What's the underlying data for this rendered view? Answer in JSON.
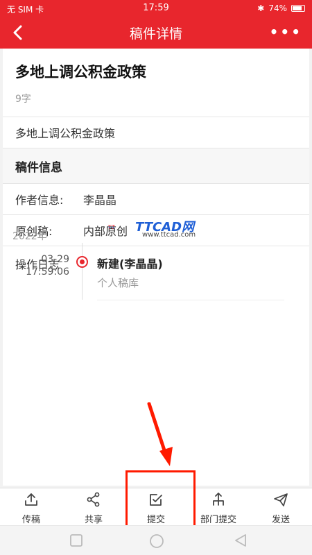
{
  "status": {
    "sim": "无 SIM 卡",
    "time": "17:59",
    "battery": "74%"
  },
  "nav": {
    "title": "稿件详情",
    "more": "•••"
  },
  "article": {
    "headline": "多地上调公积金政策",
    "word_count": "9字",
    "body_preview": "多地上调公积金政策"
  },
  "info": {
    "section_title": "稿件信息",
    "author_label": "作者信息:",
    "author_value": "李晶晶",
    "original_label": "原创稿:",
    "original_value": "内部原创"
  },
  "log": {
    "title": "操作日志",
    "year": "2022年",
    "entries": [
      {
        "date": "03-29",
        "time": "17:59:06",
        "title": "新建(李晶晶)",
        "sub": "个人稿库"
      }
    ]
  },
  "watermark": {
    "brand": "TTCAD网",
    "url": "www.ttcad.com"
  },
  "tabbar": {
    "items": [
      {
        "label": "传稿",
        "icon": "upload-icon"
      },
      {
        "label": "共享",
        "icon": "share-icon"
      },
      {
        "label": "提交",
        "icon": "submit-check-icon"
      },
      {
        "label": "部门提交",
        "icon": "department-submit-icon"
      },
      {
        "label": "发送",
        "icon": "send-icon"
      }
    ]
  },
  "colors": {
    "brand_red": "#e8262d",
    "highlight": "#ff1a00"
  }
}
